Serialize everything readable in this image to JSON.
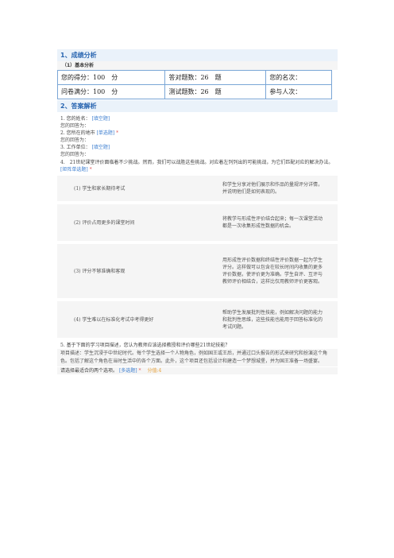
{
  "section1": {
    "title": "1、成绩分析",
    "subtitle": "（1）基本分析",
    "rows": [
      [
        "您的得分：100　分",
        "答对题数：26　题",
        "您的名次："
      ],
      [
        "问卷满分：100　分",
        "测试题数：26　题",
        "参与人次："
      ]
    ]
  },
  "section2": {
    "title": "2、答案解析",
    "q1": {
      "text": "1. 您的姓名：",
      "tag": "[填空题]",
      "answer": "您的回答为："
    },
    "q2": {
      "text": "2. 您所在的地市",
      "tag": "[单选题]",
      "star": "*",
      "answer": "您的回答为："
    },
    "q3": {
      "text": "3. 工作单位：",
      "tag": "[填空题]",
      "answer": "您的回答为："
    },
    "q4": {
      "text": "4.　21世纪课堂评价面临着不少挑战。然而，我们可以战胜这些挑战。对应着左列列出的可能挑战，为它们匹配对应的解决办法。",
      "tag": "[矩阵单选题]",
      "star": "*",
      "rows": [
        {
          "label": "(1) 学生和家长期待考试",
          "desc": "和学生分享对他们展示和作品的量规评分详情，并说明他们是如何表现的。"
        },
        {
          "label": "(2) 评价占用更多的课堂时间",
          "desc": "将教学与形成性评价结合起来；每一次课堂活动都是一次收集形成性数据的机会。"
        },
        {
          "label": "(3) 评分不够准确和客观",
          "desc": "用形成性评价数据和终结性评价数据一起为学生评分。这样做可以包含在较长时间内收集的更多评价数据，使评价更为准确。学生自评、互评与教师评价相结合，这样比仅用教师评价更客观。"
        },
        {
          "label": "(4) 学生难以在标准化考试中考得更好",
          "desc": "帮助学生发展批判性技能，例如解决问题的能力和批判性思维，这些技能也能用于回答标准化的考试问题。"
        }
      ]
    },
    "q5": {
      "text": "5. 基于下面的学习项目描述，您认为教师应该选择教授和评价哪些21世纪技能？",
      "desc": "项目描述：学生沉浸于中世纪时代。每个学生选择一个人物角色，例如国王或王后，并通过口头报告的形式来研究和扮演这个角色。包括了解这个角色在当时生活中的各个方面。此外，这个项目还包括设计和建造一个梦想城堡，并为国王准备一场盛宴。",
      "prompt": "请选择最适合的两个选项。",
      "tag": "[多选题]",
      "star": "*",
      "score": "分值:4"
    }
  }
}
